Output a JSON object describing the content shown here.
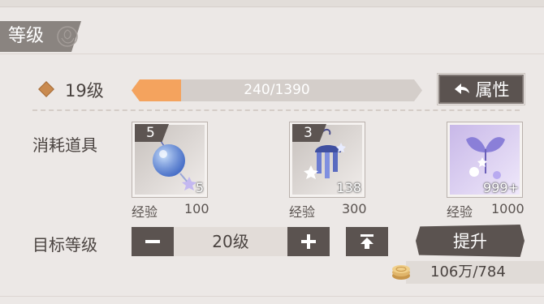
{
  "section": {
    "title": "等级",
    "icon": "rose-icon"
  },
  "level": {
    "current_label": "19级",
    "exp_text": "240/1390",
    "progress": 0.17
  },
  "attr_button": {
    "label": "属性",
    "icon": "back-arrow-icon"
  },
  "consumables": {
    "label": "消耗道具",
    "items": [
      {
        "icon": "blue-orb-charm-icon",
        "selected_count": "5",
        "qty": "5",
        "exp_label": "经验",
        "exp_value": "100"
      },
      {
        "icon": "wind-chime-charm-icon",
        "selected_count": "3",
        "qty": "138",
        "exp_label": "经验",
        "exp_value": "300"
      },
      {
        "icon": "butterfly-charm-icon",
        "selected_count": "",
        "qty": "999+",
        "exp_label": "经验",
        "exp_value": "1000"
      }
    ]
  },
  "target": {
    "label": "目标等级",
    "value": "20级",
    "minus_icon": "minus-icon",
    "plus_icon": "plus-icon",
    "max_icon": "max-level-icon"
  },
  "upgrade_button": {
    "label": "提升"
  },
  "cost": {
    "icon": "coin-icon",
    "text": "106万/784"
  },
  "colors": {
    "accent_orange": "#f4a35e",
    "button_dark": "#5b5350",
    "background": "#ece8e6"
  }
}
